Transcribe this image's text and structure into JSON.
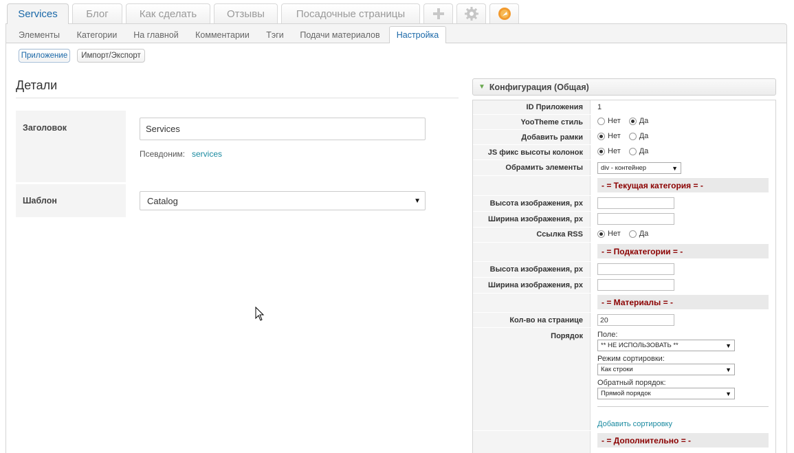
{
  "top_tabs": [
    {
      "label": "Services",
      "active": true
    },
    {
      "label": "Блог"
    },
    {
      "label": "Как сделать"
    },
    {
      "label": "Отзывы"
    },
    {
      "label": "Посадочные страницы"
    }
  ],
  "top_tab_icons": [
    "plus-icon",
    "gear-icon",
    "rocket-badge-icon"
  ],
  "sub_tabs": [
    {
      "label": "Элементы"
    },
    {
      "label": "Категории"
    },
    {
      "label": "На главной"
    },
    {
      "label": "Комментарии"
    },
    {
      "label": "Тэги"
    },
    {
      "label": "Подачи материалов"
    },
    {
      "label": "Настройка",
      "active": true
    }
  ],
  "pills": {
    "app": "Приложение",
    "import_export": "Импорт/Экспорт"
  },
  "details": {
    "title": "Детали",
    "title_label": "Заголовок",
    "title_value": "Services",
    "alias_label": "Псевдоним:",
    "alias_value": "services",
    "template_label": "Шаблон",
    "template_value": "Catalog"
  },
  "config": {
    "header": "Конфигурация (Общая)",
    "app_id_label": "ID Приложения",
    "app_id_value": "1",
    "yootheme_label": "YooTheme стиль",
    "frames_label": "Добавить рамки",
    "js_fix_label": "JS фикс высоты колонок",
    "wrap_label": "Обрамить элементы",
    "wrap_value": "div - контейнер",
    "no": "Нет",
    "yes": "Да",
    "section_current_category": "- = Текущая категория = -",
    "img_height_label": "Высота изображения, px",
    "img_width_label": "Ширина изображения, px",
    "rss_label": "Ссылка RSS",
    "section_subcategories": "- = Подкатегории = -",
    "section_items": "- = Материалы = -",
    "per_page_label": "Кол-во на странице",
    "per_page_value": "20",
    "order_label": "Порядок",
    "field_label": "Поле:",
    "field_value": "** НЕ ИСПОЛЬЗОВАТЬ **",
    "sort_mode_label": "Режим сортировки:",
    "sort_mode_value": "Как строки",
    "reverse_label": "Обратный порядок:",
    "reverse_value": "Прямой порядок",
    "add_sort_link": "Добавить сортировку",
    "section_extra": "- = Дополнительно = -"
  }
}
